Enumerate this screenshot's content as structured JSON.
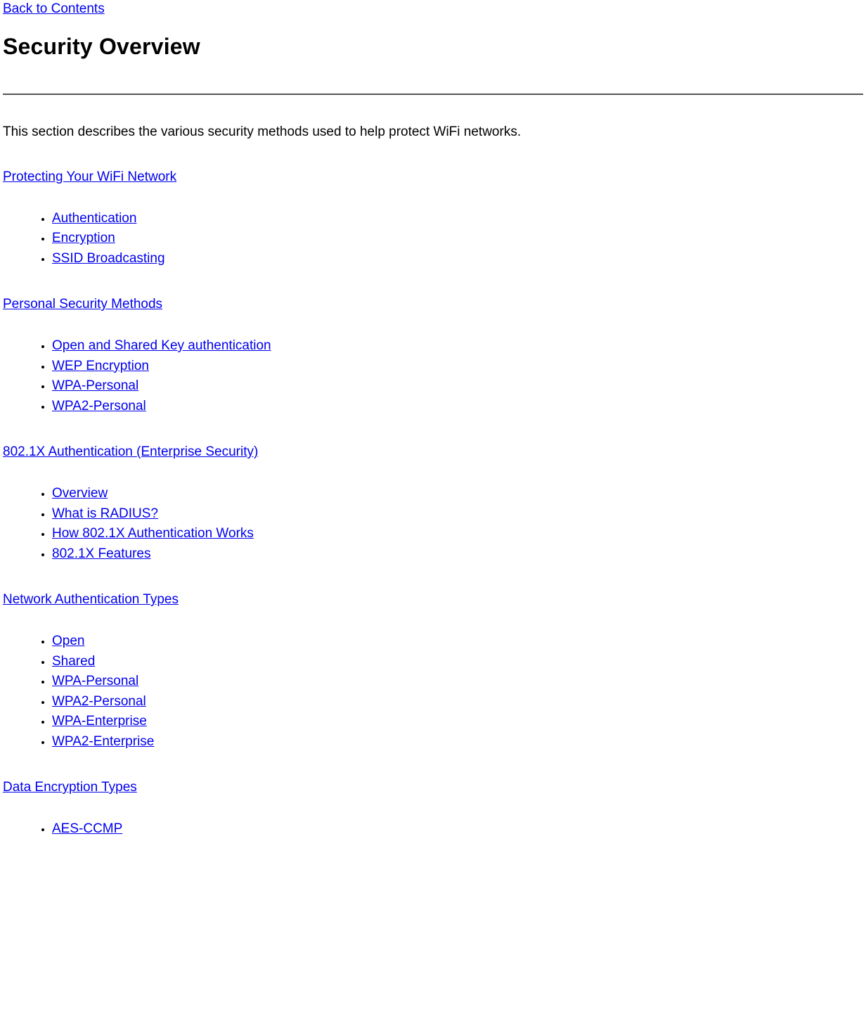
{
  "topLink": "Back to Contents",
  "title": "Security Overview",
  "intro": "This section describes the various security methods used to help protect WiFi networks.",
  "sections": [
    {
      "label": "Protecting Your WiFi Network",
      "items": [
        "Authentication",
        "Encryption",
        "SSID Broadcasting"
      ]
    },
    {
      "label": "Personal Security Methods ",
      "items": [
        "Open and Shared Key authentication",
        "WEP Encryption",
        "WPA-Personal",
        "WPA2-Personal"
      ]
    },
    {
      "label": "802.1X Authentication (Enterprise Security) ",
      "items": [
        "Overview",
        "What is RADIUS?",
        "How 802.1X Authentication Works",
        "802.1X Features"
      ]
    },
    {
      "label": "Network Authentication Types ",
      "items": [
        "Open",
        "Shared",
        "WPA-Personal ",
        "WPA2-Personal ",
        "WPA-Enterprise",
        "WPA2-Enterprise"
      ]
    },
    {
      "label": "Data Encryption Types ",
      "items": [
        "AES-CCMP"
      ]
    }
  ]
}
